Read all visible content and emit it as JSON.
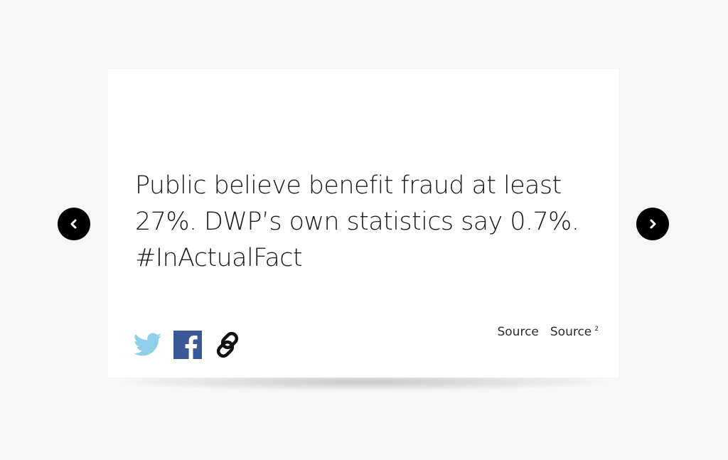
{
  "fact": {
    "line1": "Public believe benefit fraud at least",
    "line2": "27%. DWP’s own statistics say 0.7%.",
    "line3": "#InActualFact"
  },
  "share": {
    "icons": [
      "twitter-bird-icon",
      "facebook-icon",
      "link-chain-icon"
    ],
    "twitter_color": "#8fd0e8",
    "facebook_color": "#3b5998"
  },
  "sources": {
    "source1": "Source",
    "source2": "Source",
    "source2_sup": "2"
  },
  "nav": {
    "prev_icon": "chevron-left-icon",
    "next_icon": "chevron-right-icon"
  }
}
